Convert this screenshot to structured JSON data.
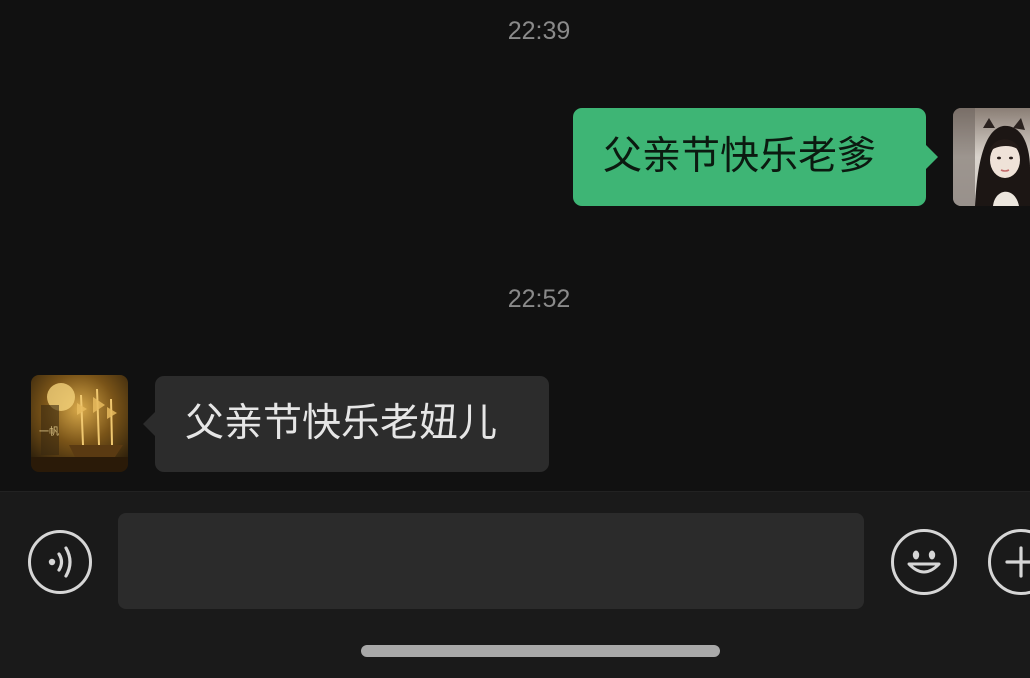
{
  "chat": {
    "messages": [
      {
        "timestamp": "22:39",
        "direction": "outgoing",
        "text": "父亲节快乐老爹",
        "avatar": "user-avatar"
      },
      {
        "timestamp": "22:52",
        "direction": "incoming",
        "text": "父亲节快乐老妞儿",
        "avatar": "contact-avatar"
      }
    ]
  },
  "input_bar": {
    "voice_icon": "voice-icon",
    "input_value": "",
    "emoji_icon": "emoji-icon",
    "plus_icon": "plus-icon"
  },
  "colors": {
    "background": "#111111",
    "outgoing_bubble": "#3eb575",
    "incoming_bubble": "#2c2c2c",
    "timestamp_text": "#8a8a8a",
    "input_bar": "#1a1a1a"
  }
}
